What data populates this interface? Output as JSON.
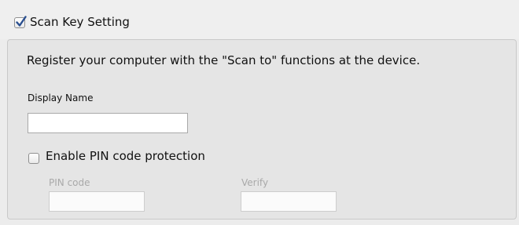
{
  "scan_key_setting": {
    "checked": true,
    "label": "Scan Key Setting"
  },
  "group": {
    "description": "Register your computer with the \"Scan to\" functions at the device.",
    "display_name": {
      "label": "Display Name",
      "value": ""
    },
    "pin_protection": {
      "checked": false,
      "label": "Enable PIN code protection"
    },
    "pin_code": {
      "label": "PIN code",
      "value": ""
    },
    "verify": {
      "label": "Verify",
      "value": ""
    }
  },
  "colors": {
    "checkmark": "#2a4f8f",
    "disabled_text": "#a9a9a9"
  }
}
